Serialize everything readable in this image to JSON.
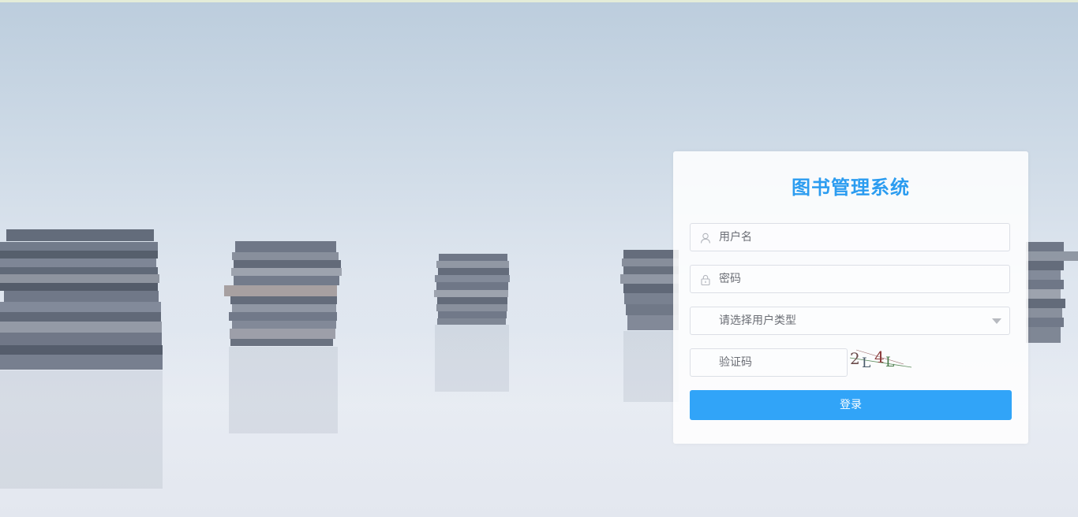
{
  "app": {
    "title": "图书管理系统"
  },
  "login": {
    "username_placeholder": "用户名",
    "password_placeholder": "密码",
    "user_type_placeholder": "请选择用户类型",
    "captcha_placeholder": "验证码",
    "captcha_text": "2L4L",
    "submit_label": "登录"
  },
  "icons": {
    "username": "user-icon",
    "password": "lock-icon",
    "user_type": "chevron-down-icon"
  },
  "colors": {
    "accent": "#2b9cf0",
    "button": "#31a4f8",
    "border": "#dcdfe6"
  }
}
